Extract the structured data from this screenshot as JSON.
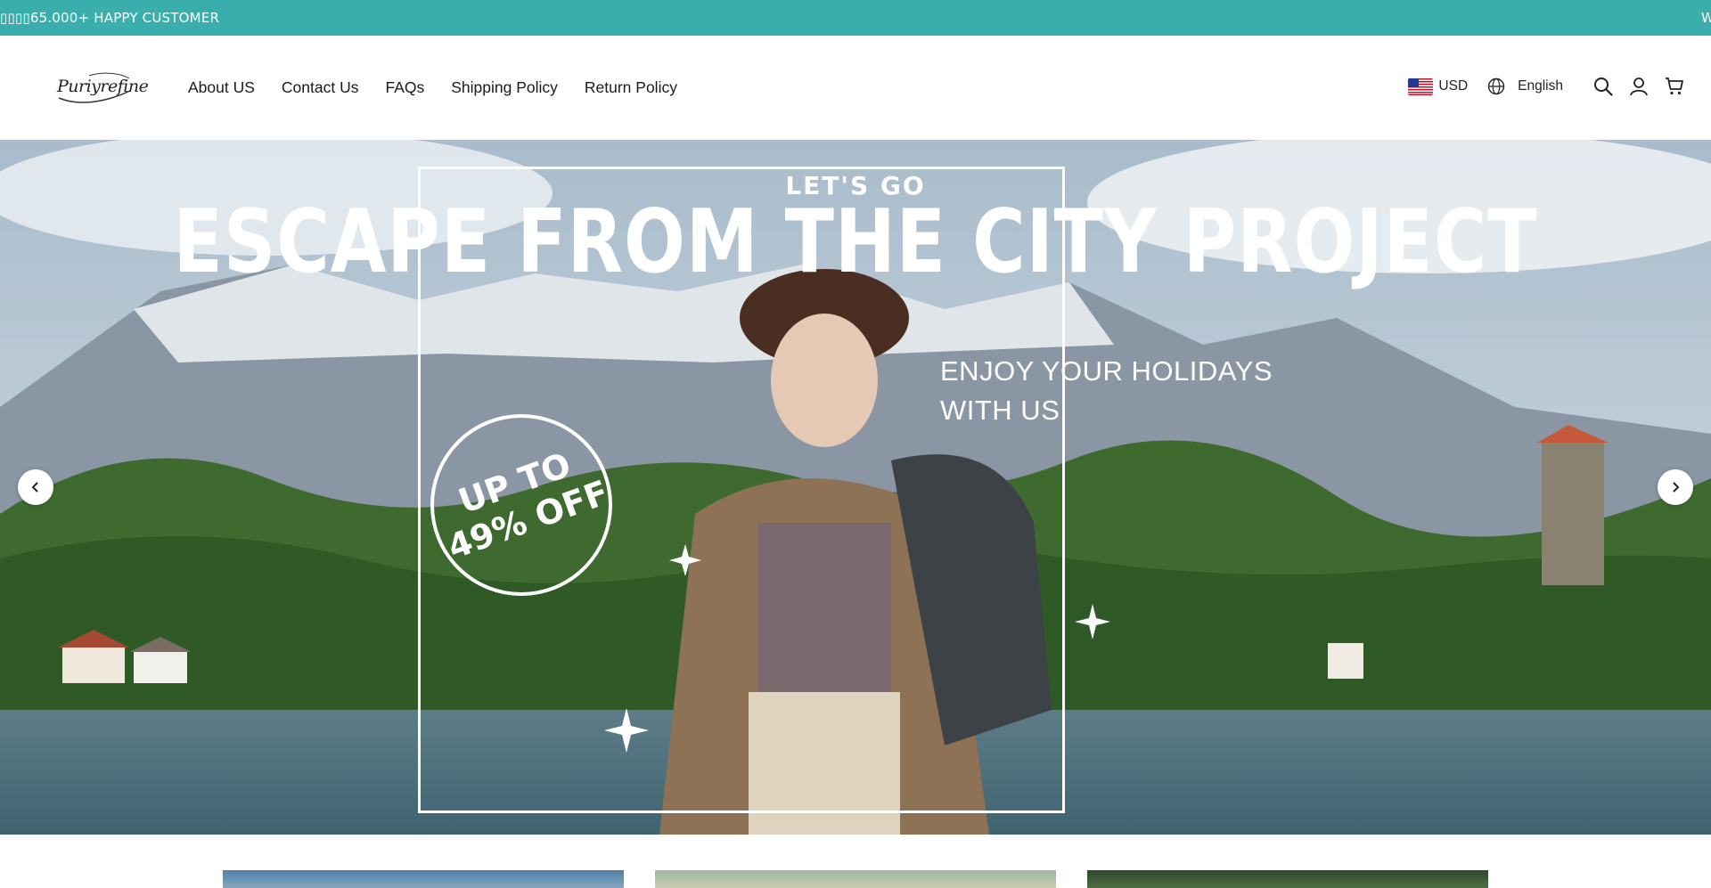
{
  "announcement": {
    "text": "65.000+ HAPPY CUSTOMER",
    "prefix_glyphs": "▯▯▯▯",
    "next_text_partial": "W"
  },
  "header": {
    "logo_text": "Puriyrefine",
    "nav": [
      "About US",
      "Contact Us",
      "FAQs",
      "Shipping Policy",
      "Return Policy"
    ],
    "currency": "USD",
    "language": "English",
    "icons": [
      "globe-icon",
      "search-icon",
      "account-icon",
      "cart-icon"
    ]
  },
  "hero": {
    "kicker": "LET'S GO",
    "headline": "ESCAPE FROM THE CITY PROJECT",
    "tagline_line1": "ENJOY YOUR HOLIDAYS",
    "tagline_line2": "WITH US",
    "badge_line1": "UP TO",
    "badge_line2": "49% OFF",
    "prev_icon": "chevron-left-icon",
    "next_icon": "chevron-right-icon"
  },
  "colors": {
    "announcement_bg": "#3aaeac",
    "text_dark": "#1a1a1a"
  }
}
